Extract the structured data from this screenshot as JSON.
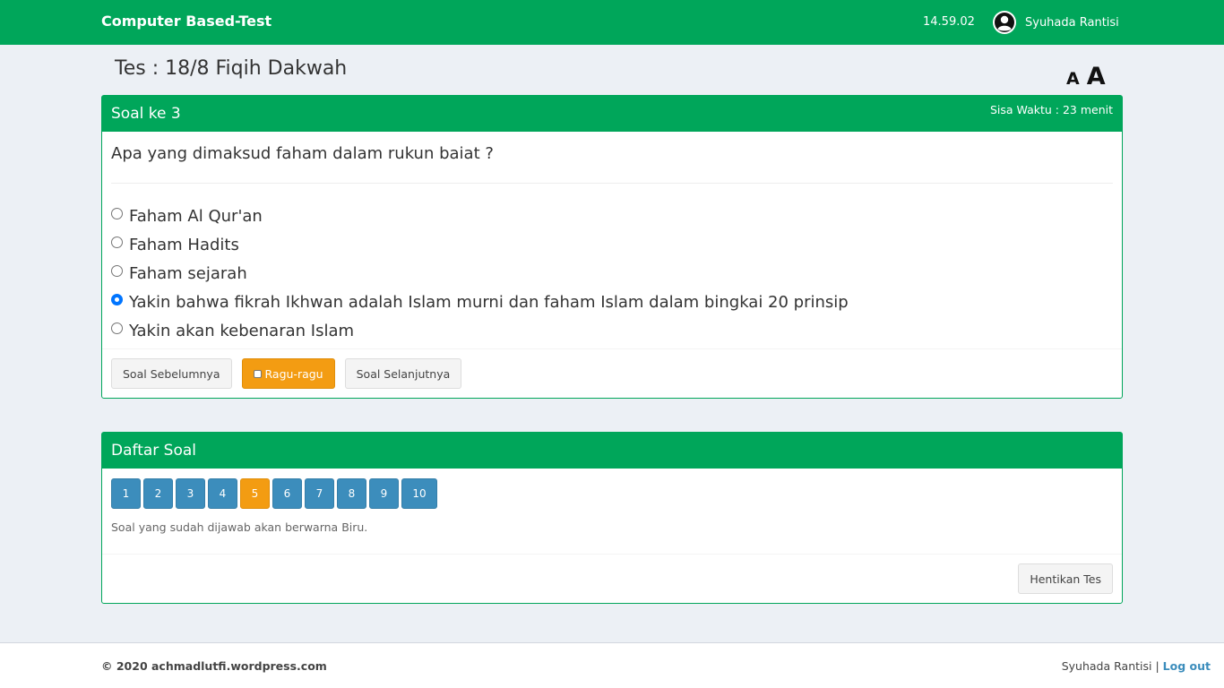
{
  "header": {
    "brand": "Computer Based-Test",
    "clock": "14.59.02",
    "username": "Syuhada Rantisi"
  },
  "page": {
    "title": "Tes : 18/8 Fiqih Dakwah",
    "font_small": "A",
    "font_large": "A"
  },
  "question_box": {
    "title": "Soal ke 3",
    "timer": "Sisa Waktu : 23 menit",
    "question": "Apa yang dimaksud faham dalam rukun baiat ?",
    "options": [
      {
        "label": "Faham Al Qur'an",
        "selected": false
      },
      {
        "label": "Faham Hadits",
        "selected": false
      },
      {
        "label": "Faham sejarah",
        "selected": false
      },
      {
        "label": "Yakin bahwa fikrah Ikhwan adalah Islam murni dan faham Islam dalam bingkai 20 prinsip",
        "selected": true
      },
      {
        "label": "Yakin akan kebenaran Islam",
        "selected": false
      }
    ],
    "prev_label": "Soal Sebelumnya",
    "doubt_label": "Ragu-ragu",
    "next_label": "Soal Selanjutnya"
  },
  "list_box": {
    "title": "Daftar Soal",
    "numbers": [
      "1",
      "2",
      "3",
      "4",
      "5",
      "6",
      "7",
      "8",
      "9",
      "10"
    ],
    "ragu_index": 4,
    "hint": "Soal yang sudah dijawab akan berwarna Biru.",
    "stop_label": "Hentikan Tes"
  },
  "footer": {
    "copyright": "© 2020 achmadlutfi.wordpress.com",
    "username": "Syuhada Rantisi",
    "separator": "|",
    "logout": "Log out"
  },
  "colors": {
    "primary_green": "#00a65a",
    "answered_blue": "#3c8dbc",
    "doubt_orange": "#f39c12",
    "background": "#ecf0f5"
  }
}
